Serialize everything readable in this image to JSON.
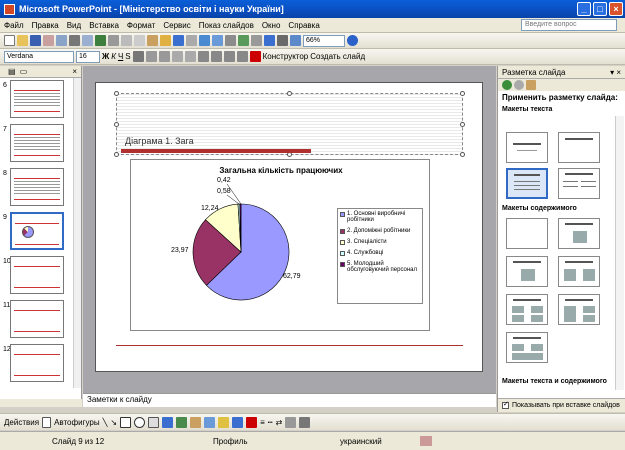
{
  "window": {
    "title": "Microsoft PowerPoint - [Міністерство освіти і науки України]"
  },
  "menu": {
    "items": [
      "Файл",
      "Правка",
      "Вид",
      "Вставка",
      "Формат",
      "Сервис",
      "Показ слайдов",
      "Окно",
      "Справка"
    ],
    "help_placeholder": "Введите вопрос"
  },
  "toolbar": {
    "zoom": "66%"
  },
  "format_toolbar": {
    "font": "Verdana",
    "size": "16",
    "bold": "Ж",
    "italic": "К",
    "underline": "Ч",
    "shadow": "S",
    "designer": "Конструктор",
    "new_slide": "Создать слайд"
  },
  "slides_pane": {
    "numbers": [
      "6",
      "7",
      "8",
      "9",
      "10",
      "11",
      "12"
    ],
    "selected": "9"
  },
  "slide": {
    "title": "Діаграма 1. Зага"
  },
  "chart_data": {
    "type": "pie",
    "title": "Загальна кількість працюючих",
    "categories": [
      "1. Основні виробничі робітники",
      "2. Допоміжні робітники",
      "3. Спеціалісти",
      "4. Службовці",
      "5. Молодший обслуговуючий персонал"
    ],
    "values": [
      62.79,
      23.97,
      12.24,
      0.58,
      0.42
    ],
    "data_labels": [
      "62,79",
      "23,97",
      "12,24",
      "0,58",
      "0,42"
    ],
    "colors": [
      "#9999ff",
      "#993366",
      "#ffffcc",
      "#ccffff",
      "#660066"
    ],
    "legend": "right"
  },
  "notes": {
    "text": "Заметки к слайду"
  },
  "drawing": {
    "actions": "Действия",
    "autoshapes": "Автофигуры"
  },
  "status": {
    "slide": "Слайд 9 из 12",
    "design": "Профиль",
    "language": "украинский"
  },
  "task_pane": {
    "title": "Разметка слайда",
    "apply": "Применить разметку слайда:",
    "text_layouts": "Макеты текста",
    "content_layouts": "Макеты содержимого",
    "text_content_layouts": "Макеты текста и содержимого",
    "show_on_insert": "Показывать при вставке слайдов"
  }
}
